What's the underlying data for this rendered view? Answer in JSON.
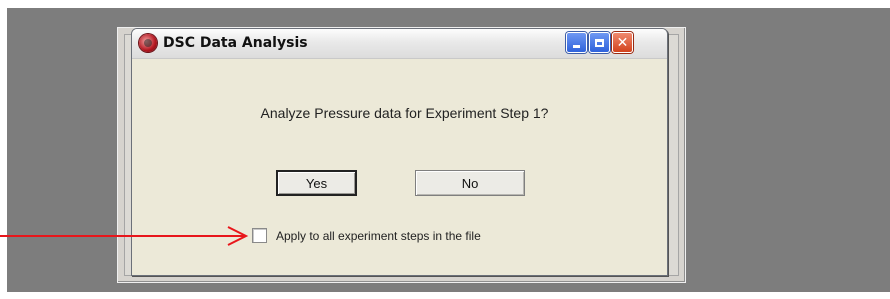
{
  "window": {
    "title": "DSC Data Analysis",
    "icon": "dsc-app-icon"
  },
  "titlebar_buttons": {
    "minimize": "_",
    "maximize": "□",
    "close": "✕"
  },
  "dialog": {
    "message": "Analyze Pressure data for Experiment Step 1?",
    "yes_label": "Yes",
    "no_label": "No",
    "checkbox_label": "Apply to all experiment steps in the file",
    "checkbox_checked": false
  },
  "annotation": {
    "arrow_color": "#e8161b"
  },
  "colors": {
    "desktop": "#7d7d7d",
    "dialog_bg": "#ece9d8",
    "titlebar_button_blue": "#2f62db",
    "close_button_red": "#d2421d"
  }
}
